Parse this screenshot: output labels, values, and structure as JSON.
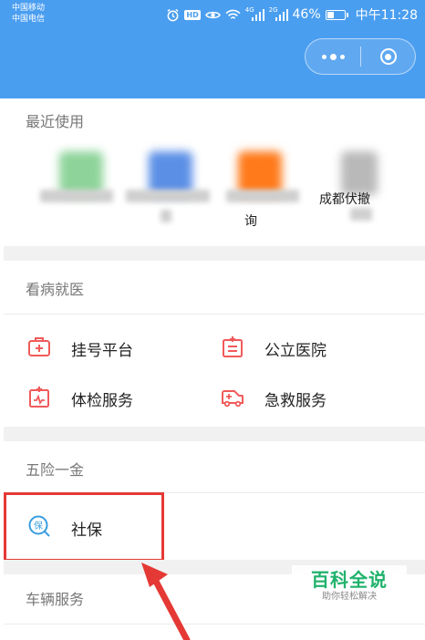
{
  "status_bar": {
    "carrier_1": "中国移动",
    "carrier_2": "中国电信",
    "net_tag_1": "4G",
    "net_tag_2": "2G",
    "battery": "46%",
    "battery_level": 0.46,
    "time": "中午11:28",
    "icons": [
      "alarm-icon",
      "hd-icon",
      "eye-icon",
      "wifi-icon",
      "signal-icon",
      "signal-icon",
      "battery-icon"
    ]
  },
  "capsule": {
    "icons": [
      "more-dots-icon",
      "close-circle-icon"
    ]
  },
  "recent": {
    "title": "最近使用",
    "items": [
      {
        "label": "",
        "blurred": true,
        "color": "#8ed49a"
      },
      {
        "label": "",
        "blurred": true,
        "color": "#5b8fe6"
      },
      {
        "label": "询",
        "blurred": true,
        "color": "#ff7a1a"
      },
      {
        "label": "成都伏撤",
        "blurred": true,
        "color": "#b9b9b9"
      }
    ]
  },
  "medical": {
    "title": "看病就医",
    "items": [
      {
        "label": "挂号平台",
        "icon": "medical-kit-icon"
      },
      {
        "label": "公立医院",
        "icon": "hospital-icon"
      },
      {
        "label": "体检服务",
        "icon": "checkup-icon"
      },
      {
        "label": "急救服务",
        "icon": "ambulance-icon"
      }
    ]
  },
  "insurance": {
    "title": "五险一金",
    "items": [
      {
        "label": "社保",
        "icon": "social-insurance-icon"
      }
    ]
  },
  "vehicle": {
    "title": "车辆服务"
  },
  "watermark": {
    "main": "百科全说",
    "sub": "助你轻松解决"
  },
  "colors": {
    "header": "#4a9ef0",
    "icon_red": "#f05a5a",
    "annotation": "#e53935",
    "watermark": "#1fb26b"
  }
}
